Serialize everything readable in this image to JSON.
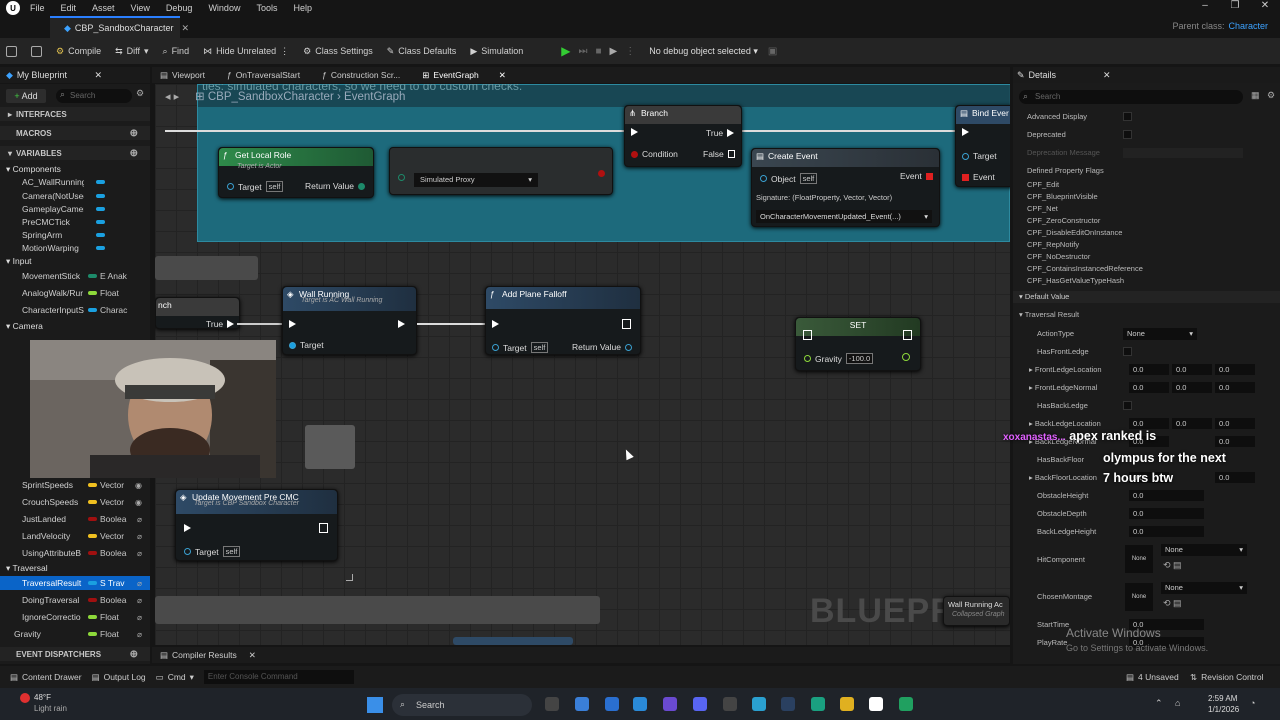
{
  "menu": [
    "File",
    "Edit",
    "Asset",
    "View",
    "Debug",
    "Window",
    "Tools",
    "Help"
  ],
  "document_tab": "CBP_SandboxCharacter",
  "parent_class_label": "Parent class:",
  "parent_class": "Character",
  "toolbar": {
    "compile": "Compile",
    "diff": "Diff",
    "find": "Find",
    "hide_unrelated": "Hide Unrelated",
    "class_settings": "Class Settings",
    "class_defaults": "Class Defaults",
    "simulation": "Simulation",
    "debug_select": "No debug object selected"
  },
  "left_tab": "My Blueprint",
  "left": {
    "add": "Add",
    "search_placeholder": "Search",
    "interfaces": "INTERFACES",
    "macros": "MACROS",
    "variables": "VARIABLES",
    "event_dispatchers": "EVENT DISPATCHERS",
    "components_cat": "Components",
    "input_cat": "Input",
    "camera_cat": "Camera",
    "traversal_cat": "Traversal",
    "components": [
      "AC_WallRunning",
      "Camera(NotUsedI",
      "GameplayCamera",
      "PreCMCTick",
      "SpringArm",
      "MotionWarping"
    ],
    "inputs": [
      {
        "name": "MovementStick",
        "type": "E Anak"
      },
      {
        "name": "AnalogWalk/Rur",
        "type": "Float"
      },
      {
        "name": "CharacterInputS",
        "type": "Charac"
      }
    ],
    "vars": [
      {
        "name": "SprintSpeeds",
        "type": "Vector"
      },
      {
        "name": "CrouchSpeeds",
        "type": "Vector"
      },
      {
        "name": "JustLanded",
        "type": "Boolea"
      },
      {
        "name": "LandVelocity",
        "type": "Vector"
      },
      {
        "name": "UsingAttributeB",
        "type": "Boolea"
      }
    ],
    "traversal": [
      {
        "name": "TraversalResult",
        "type": "S Trav"
      },
      {
        "name": "DoingTraversal",
        "type": "Boolea"
      },
      {
        "name": "IgnoreCorrectio",
        "type": "Float"
      },
      {
        "name": "Gravity",
        "type": "Float"
      }
    ]
  },
  "graph_tabs": [
    "Viewport",
    "OnTraversalStart",
    "Construction Scr...",
    "EventGraph"
  ],
  "breadcrumb": {
    "root": "CBP_SandboxCharacter",
    "leaf": "EventGraph"
  },
  "comment_text": "ties: simulated characters, so we need to do custom checks.",
  "nodes": {
    "get_local_role": {
      "title": "Get Local Role",
      "sub": "Target is Actor",
      "target": "Target",
      "self": "self",
      "ret": "Return Value"
    },
    "enum_value": "Simulated Proxy",
    "branch": {
      "title": "Branch",
      "true": "True",
      "false": "False",
      "cond": "Condition"
    },
    "create_event": {
      "title": "Create Event",
      "object": "Object",
      "self": "self",
      "event": "Event",
      "signature": "Signature: (FloatProperty, Vector, Vector)",
      "func": "OnCharacterMovementUpdated_Event(...)"
    },
    "bind_event": {
      "title": "Bind Ever",
      "target": "Target",
      "event": "Event"
    },
    "wall_running": {
      "title": "Wall Running",
      "sub": "Target is AC Wall Running",
      "target": "Target"
    },
    "add_plane_falloff": {
      "title": "Add Plane Falloff",
      "target": "Target",
      "self": "self",
      "ret": "Return Value"
    },
    "set": {
      "title": "SET",
      "gravity": "Gravity",
      "value": "-100.0"
    },
    "branch2": {
      "title": "nch",
      "true": "True"
    },
    "update_movement": {
      "title": "Update Movement Pre CMC",
      "sub": "Target is CBP Sandbox Character",
      "target": "Target",
      "self": "self"
    },
    "collapsed": {
      "title": "Wall Running Ac",
      "sub": "Collapsed Graph"
    }
  },
  "watermark": "BLUEPRINT",
  "compiler_results": "Compiler Results",
  "details": {
    "title": "Details",
    "search": "Search",
    "props": [
      {
        "label": "Advanced Display"
      },
      {
        "label": "Deprecated"
      },
      {
        "label": "Deprecation Message"
      }
    ],
    "flags_title": "Defined Property Flags",
    "flags": [
      "CPF_Edit",
      "CPF_BlueprintVisible",
      "CPF_Net",
      "CPF_ZeroConstructor",
      "CPF_DisableEditOnInstance",
      "CPF_RepNotify",
      "CPF_NoDestructor",
      "CPF_ContainsInstancedReference",
      "CPF_HasGetValueTypeHash"
    ],
    "default_value": "Default Value",
    "traversal_result": "Traversal Result",
    "fields": [
      {
        "label": "ActionType",
        "value": "None"
      },
      {
        "label": "HasFrontLedge"
      },
      {
        "label": "FrontLedgeLocation",
        "v": [
          "0.0",
          "0.0",
          "0.0"
        ]
      },
      {
        "label": "FrontLedgeNormal",
        "v": [
          "0.0",
          "0.0",
          "0.0"
        ]
      },
      {
        "label": "HasBackLedge"
      },
      {
        "label": "BackLedgeLocation",
        "v": [
          "0.0",
          "0.0",
          "0.0"
        ]
      },
      {
        "label": "BackLedgeNormal",
        "v": [
          "0.0",
          "",
          "0.0"
        ]
      },
      {
        "label": "HasBackFloor"
      },
      {
        "label": "BackFloorLocation",
        "v": [
          "0.0",
          "",
          "0.0"
        ]
      },
      {
        "label": "ObstacleHeight",
        "v": [
          "0.0"
        ]
      },
      {
        "label": "ObstacleDepth",
        "v": [
          "0.0"
        ]
      },
      {
        "label": "BackLedgeHeight",
        "v": [
          "0.0"
        ]
      },
      {
        "label": "HitComponent",
        "value": "None"
      },
      {
        "label": "ChosenMontage",
        "value": "None"
      },
      {
        "label": "StartTime",
        "v": [
          "0.0"
        ]
      },
      {
        "label": "PlayRate",
        "v": [
          "0.0"
        ]
      }
    ],
    "none_thumb": "None"
  },
  "status": {
    "content_drawer": "Content Drawer",
    "output_log": "Output Log",
    "cmd": "Cmd",
    "cmd_placeholder": "Enter Console Command",
    "unsaved": "4 Unsaved",
    "revision": "Revision Control"
  },
  "taskbar": {
    "weather_temp": "48°F",
    "weather_desc": "Light rain",
    "search": "Search",
    "time": "2:59 AM",
    "date": "1/1/2026"
  },
  "overlay": {
    "chat_user": "xoxanastas...",
    "chat_lines": [
      "apex ranked is",
      "olympus for the next",
      "7 hours btw"
    ],
    "activate": "Activate Windows",
    "activate_sub": "Go to Settings to activate Windows."
  }
}
